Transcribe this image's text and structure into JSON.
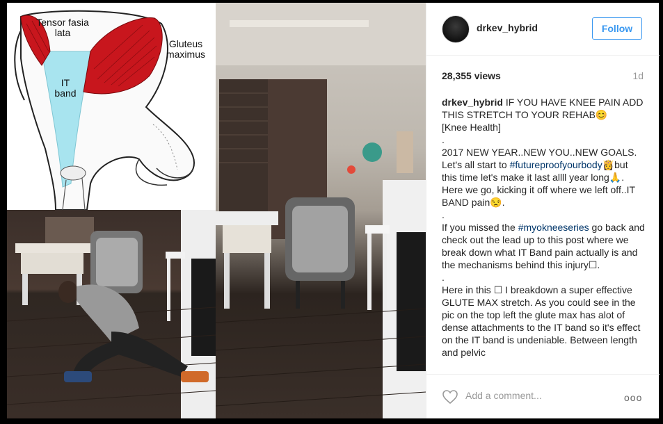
{
  "post": {
    "username": "drkev_hybrid",
    "follow_label": "Follow",
    "views": "28,355 views",
    "age": "1d",
    "caption_author": "drkev_hybrid",
    "caption_line1": "IF YOU HAVE KNEE PAIN ADD THIS STRETCH TO YOUR REHAB😊",
    "caption_line2": "[Knee Health]",
    "dot1": ".",
    "para1_a": "2017 NEW YEAR..NEW YOU..NEW GOALS. Let's all start to ",
    "hashtag1": "#futureproofyourbody",
    "para1_b": "👸but this time let's make it last allll year long🙏. Here we go, kicking it off where we left off..IT BAND pain😒.",
    "dot2": ".",
    "para2_a": "If you missed the ",
    "hashtag2": "#myokneeseries",
    "para2_b": " go back and check out the lead up to this post where we break down what IT Band pain actually is and the mechanisms behind this injury☐.",
    "dot3": ".",
    "para3": "Here in this ☐ I breakdown a super effective GLUTE MAX stretch. As you could see in the pic on the top left the glute max has alot of dense attachments to the IT band so it's effect on the IT band is undeniable. Between length and pelvic",
    "comment_placeholder": "Add a comment...",
    "more_label": "ooo"
  },
  "diagram": {
    "label_tfl": "Tensor fasia lata",
    "label_gm": "Gluteus maximus",
    "label_it": "IT band"
  },
  "colors": {
    "accent": "#3897f0",
    "hashtag": "#003569",
    "muscle": "#c8161d",
    "it_band": "#a8e4ef"
  }
}
